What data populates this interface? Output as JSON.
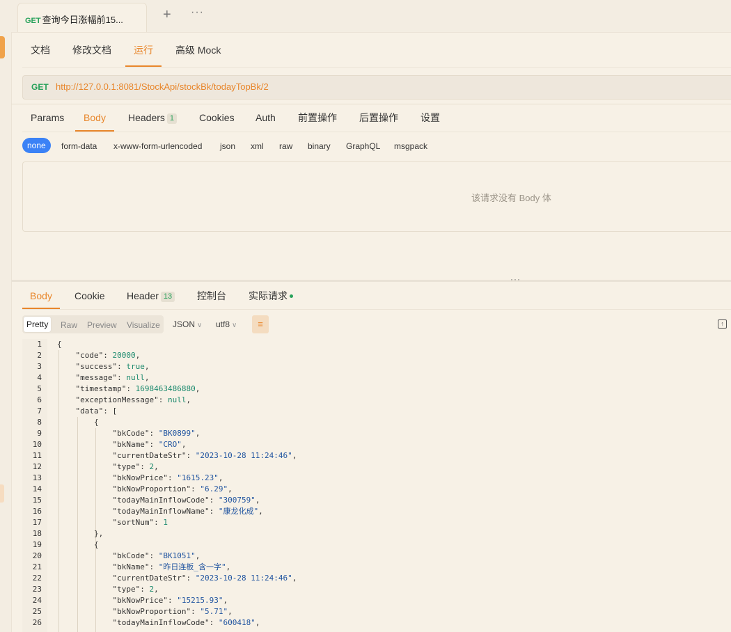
{
  "tab": {
    "method": "GET",
    "title": "查询今日涨幅前15...",
    "plus": "+",
    "more": "···"
  },
  "subnav": [
    "文档",
    "修改文档",
    "运行",
    "高级 Mock"
  ],
  "url": {
    "method": "GET",
    "value": "http://127.0.0.1:8081/StockApi/stockBk/todayTopBk/2"
  },
  "request_tabs": [
    {
      "label": "Params"
    },
    {
      "label": "Body"
    },
    {
      "label": "Headers",
      "badge": "1"
    },
    {
      "label": "Cookies"
    },
    {
      "label": "Auth"
    },
    {
      "label": "前置操作"
    },
    {
      "label": "后置操作"
    },
    {
      "label": "设置"
    }
  ],
  "body_types": [
    "none",
    "form-data",
    "x-www-form-urlencoded",
    "json",
    "xml",
    "raw",
    "binary",
    "GraphQL",
    "msgpack"
  ],
  "empty_body_message": "该请求没有 Body 体",
  "splitter_handle": "···",
  "response_tabs": [
    {
      "label": "Body"
    },
    {
      "label": "Cookie"
    },
    {
      "label": "Header",
      "badge": "13"
    },
    {
      "label": "控制台"
    },
    {
      "label": "实际请求"
    }
  ],
  "view_modes": [
    "Pretty",
    "Raw",
    "Preview",
    "Visualize"
  ],
  "format_select": "JSON",
  "encoding_select": "utf8",
  "colors": {
    "accent": "#e8862b",
    "get": "#27a15a",
    "selected_pill": "#3b82f6",
    "background": "#f7f1e6"
  },
  "code_lines": [
    {
      "n": "1",
      "ind": 0,
      "parts": [
        [
          "p",
          "{"
        ]
      ]
    },
    {
      "n": "2",
      "ind": 1,
      "parts": [
        [
          "k",
          "\"code\""
        ],
        [
          "p",
          ": "
        ],
        [
          "n",
          "20000"
        ],
        [
          "p",
          ","
        ]
      ]
    },
    {
      "n": "3",
      "ind": 1,
      "parts": [
        [
          "k",
          "\"success\""
        ],
        [
          "p",
          ": "
        ],
        [
          "n",
          "true"
        ],
        [
          "p",
          ","
        ]
      ]
    },
    {
      "n": "4",
      "ind": 1,
      "parts": [
        [
          "k",
          "\"message\""
        ],
        [
          "p",
          ": "
        ],
        [
          "n",
          "null"
        ],
        [
          "p",
          ","
        ]
      ]
    },
    {
      "n": "5",
      "ind": 1,
      "parts": [
        [
          "k",
          "\"timestamp\""
        ],
        [
          "p",
          ": "
        ],
        [
          "n",
          "1698463486880"
        ],
        [
          "p",
          ","
        ]
      ]
    },
    {
      "n": "6",
      "ind": 1,
      "parts": [
        [
          "k",
          "\"exceptionMessage\""
        ],
        [
          "p",
          ": "
        ],
        [
          "n",
          "null"
        ],
        [
          "p",
          ","
        ]
      ]
    },
    {
      "n": "7",
      "ind": 1,
      "parts": [
        [
          "k",
          "\"data\""
        ],
        [
          "p",
          ": ["
        ]
      ]
    },
    {
      "n": "8",
      "ind": 2,
      "parts": [
        [
          "p",
          "{"
        ]
      ]
    },
    {
      "n": "9",
      "ind": 3,
      "parts": [
        [
          "k",
          "\"bkCode\""
        ],
        [
          "p",
          ": "
        ],
        [
          "s",
          "\"BK0899\""
        ],
        [
          "p",
          ","
        ]
      ]
    },
    {
      "n": "10",
      "ind": 3,
      "parts": [
        [
          "k",
          "\"bkName\""
        ],
        [
          "p",
          ": "
        ],
        [
          "s",
          "\"CRO\""
        ],
        [
          "p",
          ","
        ]
      ]
    },
    {
      "n": "11",
      "ind": 3,
      "parts": [
        [
          "k",
          "\"currentDateStr\""
        ],
        [
          "p",
          ": "
        ],
        [
          "s",
          "\"2023-10-28 11:24:46\""
        ],
        [
          "p",
          ","
        ]
      ]
    },
    {
      "n": "12",
      "ind": 3,
      "parts": [
        [
          "k",
          "\"type\""
        ],
        [
          "p",
          ": "
        ],
        [
          "n",
          "2"
        ],
        [
          "p",
          ","
        ]
      ]
    },
    {
      "n": "13",
      "ind": 3,
      "parts": [
        [
          "k",
          "\"bkNowPrice\""
        ],
        [
          "p",
          ": "
        ],
        [
          "s",
          "\"1615.23\""
        ],
        [
          "p",
          ","
        ]
      ]
    },
    {
      "n": "14",
      "ind": 3,
      "parts": [
        [
          "k",
          "\"bkNowProportion\""
        ],
        [
          "p",
          ": "
        ],
        [
          "s",
          "\"6.29\""
        ],
        [
          "p",
          ","
        ]
      ]
    },
    {
      "n": "15",
      "ind": 3,
      "parts": [
        [
          "k",
          "\"todayMainInflowCode\""
        ],
        [
          "p",
          ": "
        ],
        [
          "s",
          "\"300759\""
        ],
        [
          "p",
          ","
        ]
      ]
    },
    {
      "n": "16",
      "ind": 3,
      "parts": [
        [
          "k",
          "\"todayMainInflowName\""
        ],
        [
          "p",
          ": "
        ],
        [
          "s",
          "\"康龙化成\""
        ],
        [
          "p",
          ","
        ]
      ]
    },
    {
      "n": "17",
      "ind": 3,
      "parts": [
        [
          "k",
          "\"sortNum\""
        ],
        [
          "p",
          ": "
        ],
        [
          "n",
          "1"
        ]
      ]
    },
    {
      "n": "18",
      "ind": 2,
      "parts": [
        [
          "p",
          "},"
        ]
      ]
    },
    {
      "n": "19",
      "ind": 2,
      "parts": [
        [
          "p",
          "{"
        ]
      ]
    },
    {
      "n": "20",
      "ind": 3,
      "parts": [
        [
          "k",
          "\"bkCode\""
        ],
        [
          "p",
          ": "
        ],
        [
          "s",
          "\"BK1051\""
        ],
        [
          "p",
          ","
        ]
      ]
    },
    {
      "n": "21",
      "ind": 3,
      "parts": [
        [
          "k",
          "\"bkName\""
        ],
        [
          "p",
          ": "
        ],
        [
          "s",
          "\"昨日连板_含一字\""
        ],
        [
          "p",
          ","
        ]
      ]
    },
    {
      "n": "22",
      "ind": 3,
      "parts": [
        [
          "k",
          "\"currentDateStr\""
        ],
        [
          "p",
          ": "
        ],
        [
          "s",
          "\"2023-10-28 11:24:46\""
        ],
        [
          "p",
          ","
        ]
      ]
    },
    {
      "n": "23",
      "ind": 3,
      "parts": [
        [
          "k",
          "\"type\""
        ],
        [
          "p",
          ": "
        ],
        [
          "n",
          "2"
        ],
        [
          "p",
          ","
        ]
      ]
    },
    {
      "n": "24",
      "ind": 3,
      "parts": [
        [
          "k",
          "\"bkNowPrice\""
        ],
        [
          "p",
          ": "
        ],
        [
          "s",
          "\"15215.93\""
        ],
        [
          "p",
          ","
        ]
      ]
    },
    {
      "n": "25",
      "ind": 3,
      "parts": [
        [
          "k",
          "\"bkNowProportion\""
        ],
        [
          "p",
          ": "
        ],
        [
          "s",
          "\"5.71\""
        ],
        [
          "p",
          ","
        ]
      ]
    },
    {
      "n": "26",
      "ind": 3,
      "parts": [
        [
          "k",
          "\"todayMainInflowCode\""
        ],
        [
          "p",
          ": "
        ],
        [
          "s",
          "\"600418\""
        ],
        [
          "p",
          ","
        ]
      ]
    }
  ]
}
